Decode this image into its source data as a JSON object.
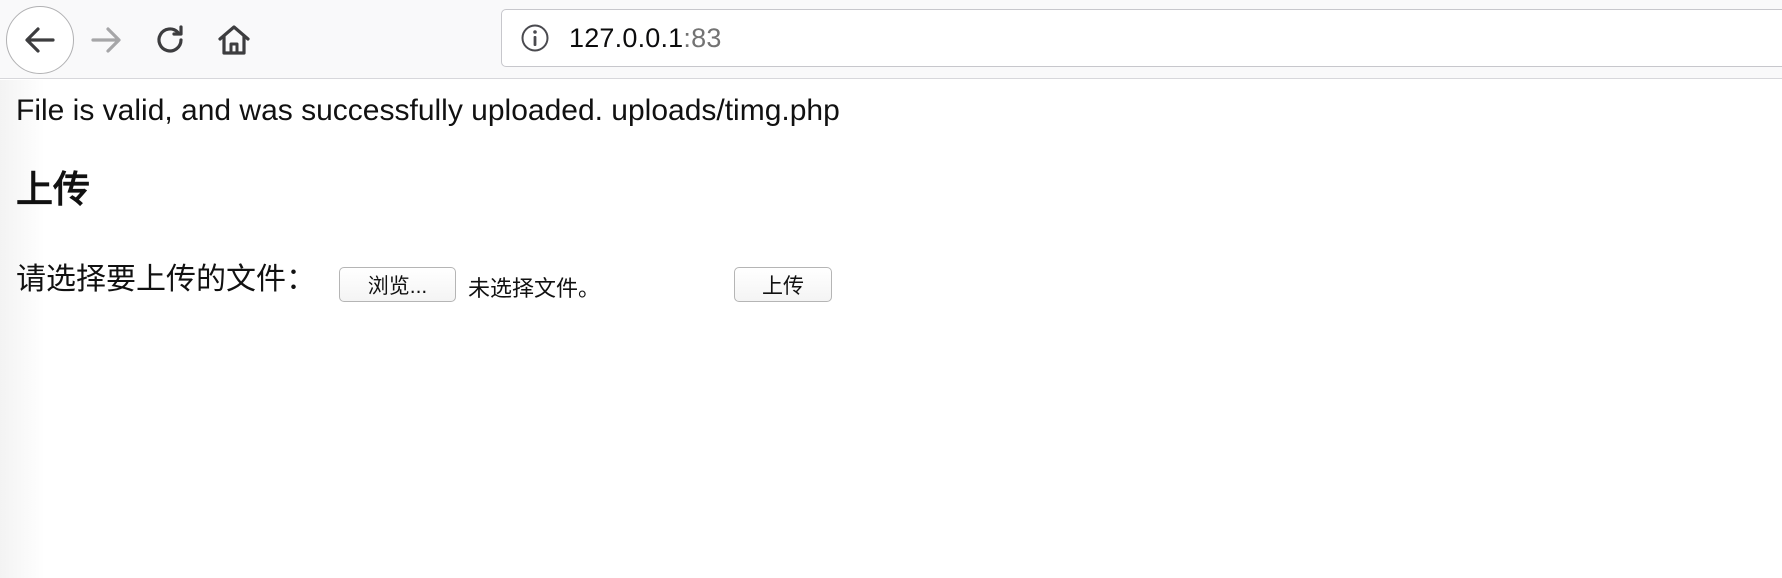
{
  "browser": {
    "url_host": "127.0.0.1",
    "url_port": ":83"
  },
  "page": {
    "message": "File is valid, and was successfully uploaded. uploads/timg.php",
    "heading": "上传",
    "form": {
      "label": "请选择要上传的文件：",
      "browse_button": "浏览...",
      "file_status": "未选择文件。",
      "submit_button": "上传"
    }
  }
}
